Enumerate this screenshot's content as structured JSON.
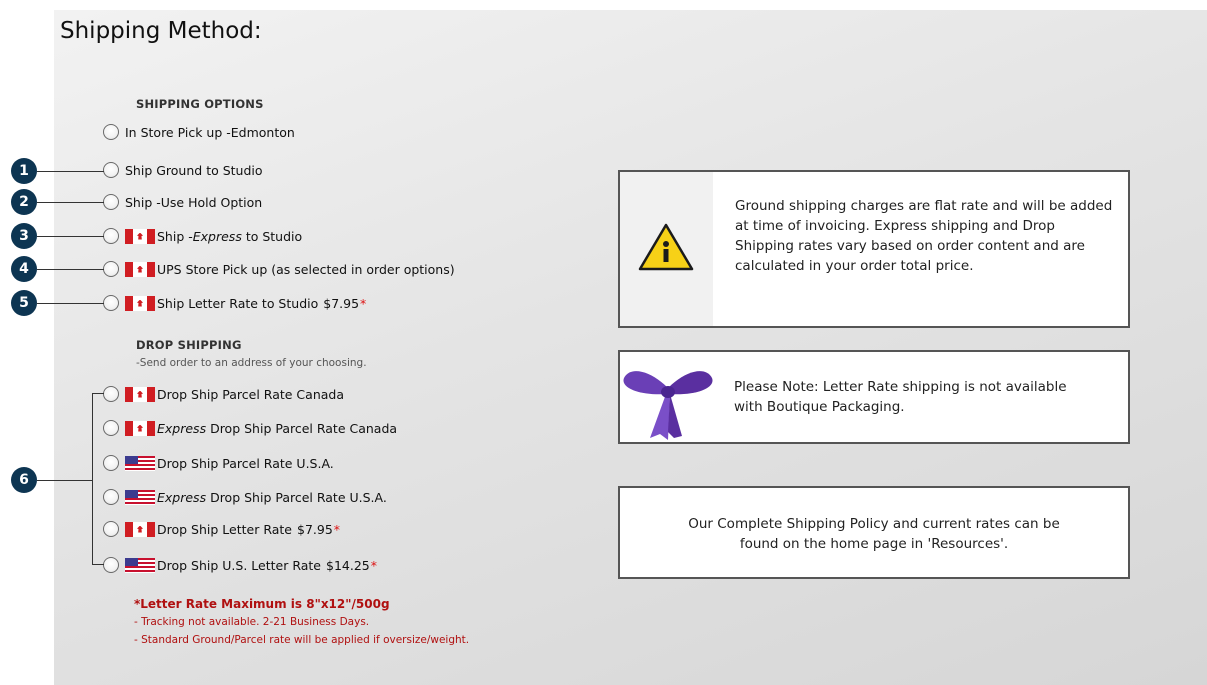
{
  "page": {
    "title": "Shipping Method:"
  },
  "shipping_options": {
    "heading": "SHIPPING OPTIONS",
    "items": [
      {
        "label": "In Store Pick up -Edmonton",
        "flag": "none"
      },
      {
        "label": "Ship Ground to Studio",
        "flag": "none"
      },
      {
        "label": "Ship -Use Hold Option",
        "flag": "none"
      },
      {
        "label_pre": "Ship - ",
        "label_em": "Express",
        "label_post": " to Studio",
        "flag": "canada-flag"
      },
      {
        "label": "UPS Store Pick up (as selected in order options)",
        "flag": "canada-flag"
      },
      {
        "label": "Ship Letter Rate to Studio",
        "price": "$7.95",
        "asterisk": "*",
        "flag": "canada-flag"
      }
    ]
  },
  "drop_shipping": {
    "heading": "DROP SHIPPING",
    "subheading": "-Send order to an address of your choosing.",
    "items": [
      {
        "label": "Drop Ship Parcel Rate Canada",
        "flag": "canada-flag"
      },
      {
        "label_em": "Express",
        "label_post": " Drop Ship Parcel Rate Canada",
        "flag": "canada-flag"
      },
      {
        "label": "Drop Ship Parcel Rate U.S.A.",
        "flag": "usa-flag"
      },
      {
        "label_em": "Express",
        "label_post": " Drop Ship Parcel Rate U.S.A.",
        "flag": "usa-flag"
      },
      {
        "label": "Drop Ship Letter Rate",
        "price": "$7.95",
        "asterisk": "*",
        "flag": "canada-flag"
      },
      {
        "label": "Drop Ship U.S. Letter Rate",
        "price": "$14.25",
        "asterisk": "*",
        "flag": "usa-flag"
      }
    ]
  },
  "notes": {
    "max_rule": "*Letter Rate Maximum is 8\"x12\"/500g",
    "tracking": "- Tracking not available. 2-21 Business Days.",
    "oversize": "- Standard Ground/Parcel rate will be applied if oversize/weight."
  },
  "callouts": [
    "1",
    "2",
    "3",
    "4",
    "5",
    "6"
  ],
  "info_boxes": {
    "ground_notice": "Ground shipping charges are flat rate and will be added at time of invoicing. Express shipping and Drop Shipping rates vary based on order content and are calculated in your order total price.",
    "letter_note": "Please Note: Letter Rate shipping is not available with Boutique Packaging.",
    "policy_note_1": "Our Complete Shipping Policy and current rates can be",
    "policy_note_2": "found on the home page in 'Resources'."
  },
  "colors": {
    "badge": "#0d3552",
    "red": "#b01010",
    "ribbon": "#6a3fb6"
  }
}
